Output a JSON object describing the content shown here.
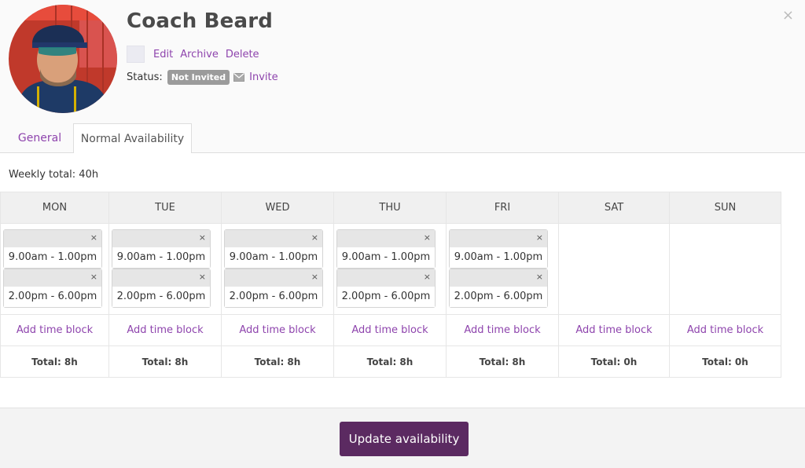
{
  "profile": {
    "name": "Coach Beard",
    "actions": {
      "edit": "Edit",
      "archive": "Archive",
      "delete": "Delete"
    },
    "status_label": "Status:",
    "status_value": "Not Invited",
    "invite_label": "Invite",
    "close_glyph": "×"
  },
  "tabs": [
    {
      "label": "General"
    },
    {
      "label": "Normal Availability"
    }
  ],
  "availability": {
    "weekly_total": "Weekly total: 40h",
    "remove_glyph": "×",
    "add_label": "Add time block",
    "days": [
      {
        "name": "MON",
        "blocks": [
          "9.00am - 1.00pm",
          "2.00pm - 6.00pm"
        ],
        "total": "Total: 8h"
      },
      {
        "name": "TUE",
        "blocks": [
          "9.00am - 1.00pm",
          "2.00pm - 6.00pm"
        ],
        "total": "Total: 8h"
      },
      {
        "name": "WED",
        "blocks": [
          "9.00am - 1.00pm",
          "2.00pm - 6.00pm"
        ],
        "total": "Total: 8h"
      },
      {
        "name": "THU",
        "blocks": [
          "9.00am - 1.00pm",
          "2.00pm - 6.00pm"
        ],
        "total": "Total: 8h"
      },
      {
        "name": "FRI",
        "blocks": [
          "9.00am - 1.00pm",
          "2.00pm - 6.00pm"
        ],
        "total": "Total: 8h"
      },
      {
        "name": "SAT",
        "blocks": [],
        "total": "Total: 0h"
      },
      {
        "name": "SUN",
        "blocks": [],
        "total": "Total: 0h"
      }
    ]
  },
  "footer": {
    "update_label": "Update availability"
  },
  "colors": {
    "accent": "#8e44ad",
    "button": "#5b2a61",
    "badge": "#9b9b9b"
  }
}
